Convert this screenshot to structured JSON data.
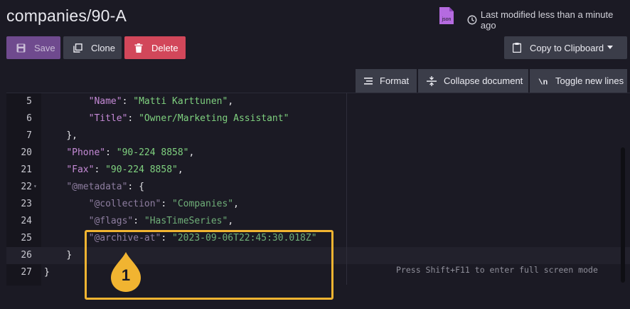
{
  "header": {
    "title": "companies/90-A",
    "file_type_icon_label": "json",
    "modified": "Last modified less than a minute ago"
  },
  "toolbar": {
    "save_label": "Save",
    "clone_label": "Clone",
    "delete_label": "Delete",
    "copy_label": "Copy to Clipboard"
  },
  "editor_toolbar": {
    "format_label": "Format",
    "collapse_label": "Collapse document",
    "toggle_label": "Toggle new lines"
  },
  "editor": {
    "lines": [
      {
        "num": "5",
        "indent": "        ",
        "key": "\"Name\"",
        "sep": ": ",
        "value": "\"Matti Karttunen\"",
        "tail": ",",
        "dim": false
      },
      {
        "num": "6",
        "indent": "        ",
        "key": "\"Title\"",
        "sep": ": ",
        "value": "\"Owner/Marketing Assistant\"",
        "tail": "",
        "dim": false
      },
      {
        "num": "7",
        "indent": "    ",
        "key": "",
        "sep": "",
        "value": "",
        "tail": "},",
        "dim": false
      },
      {
        "num": "20",
        "indent": "    ",
        "key": "\"Phone\"",
        "sep": ": ",
        "value": "\"90-224 8858\"",
        "tail": ",",
        "dim": false
      },
      {
        "num": "21",
        "indent": "    ",
        "key": "\"Fax\"",
        "sep": ": ",
        "value": "\"90-224 8858\"",
        "tail": ",",
        "dim": false
      },
      {
        "num": "22",
        "indent": "    ",
        "key": "\"@metadata\"",
        "sep": ": ",
        "value": "",
        "tail": "{",
        "dim": true
      },
      {
        "num": "23",
        "indent": "        ",
        "key": "\"@collection\"",
        "sep": ": ",
        "value": "\"Companies\"",
        "tail": ",",
        "dim": true
      },
      {
        "num": "24",
        "indent": "        ",
        "key": "\"@flags\"",
        "sep": ": ",
        "value": "\"HasTimeSeries\"",
        "tail": ",",
        "dim": true
      },
      {
        "num": "25",
        "indent": "        ",
        "key": "\"@archive-at\"",
        "sep": ": ",
        "value": "\"2023-09-06T22:45:30.018Z\"",
        "tail": "",
        "dim": true
      },
      {
        "num": "26",
        "indent": "    ",
        "key": "",
        "sep": "",
        "value": "",
        "tail": "}",
        "dim": false
      },
      {
        "num": "27",
        "indent": "",
        "key": "",
        "sep": "",
        "value": "",
        "tail": "}",
        "dim": false
      }
    ],
    "fullscreen_hint": "Press Shift+F11 to enter full screen mode"
  },
  "annotation": {
    "callout_number": "1",
    "color": "#f1b431"
  }
}
